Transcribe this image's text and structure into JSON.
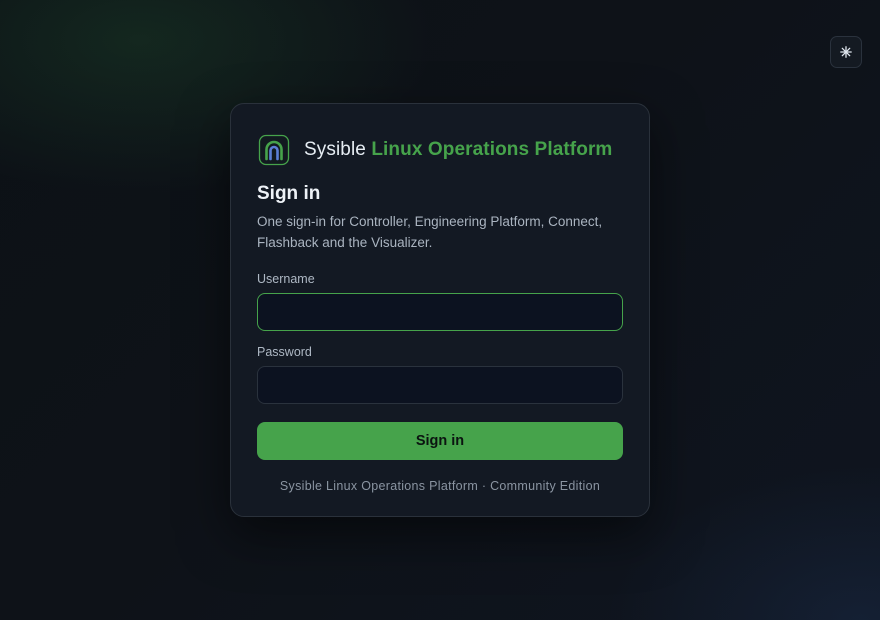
{
  "theme_toggle": {
    "icon": "sun-icon"
  },
  "brand": {
    "logo_icon": "arch-logo-icon",
    "name_first": "Sysible",
    "name_rest": "Linux Operations Platform",
    "accent_color": "#46a34b"
  },
  "login": {
    "title": "Sign in",
    "subtitle": "One sign-in for Controller, Engineering Platform, Connect, Flashback and the Visualizer.",
    "username_label": "Username",
    "username_value": "",
    "password_label": "Password",
    "password_value": "",
    "submit_label": "Sign in"
  },
  "footer": {
    "text": "Sysible Linux Operations Platform · Community Edition"
  }
}
